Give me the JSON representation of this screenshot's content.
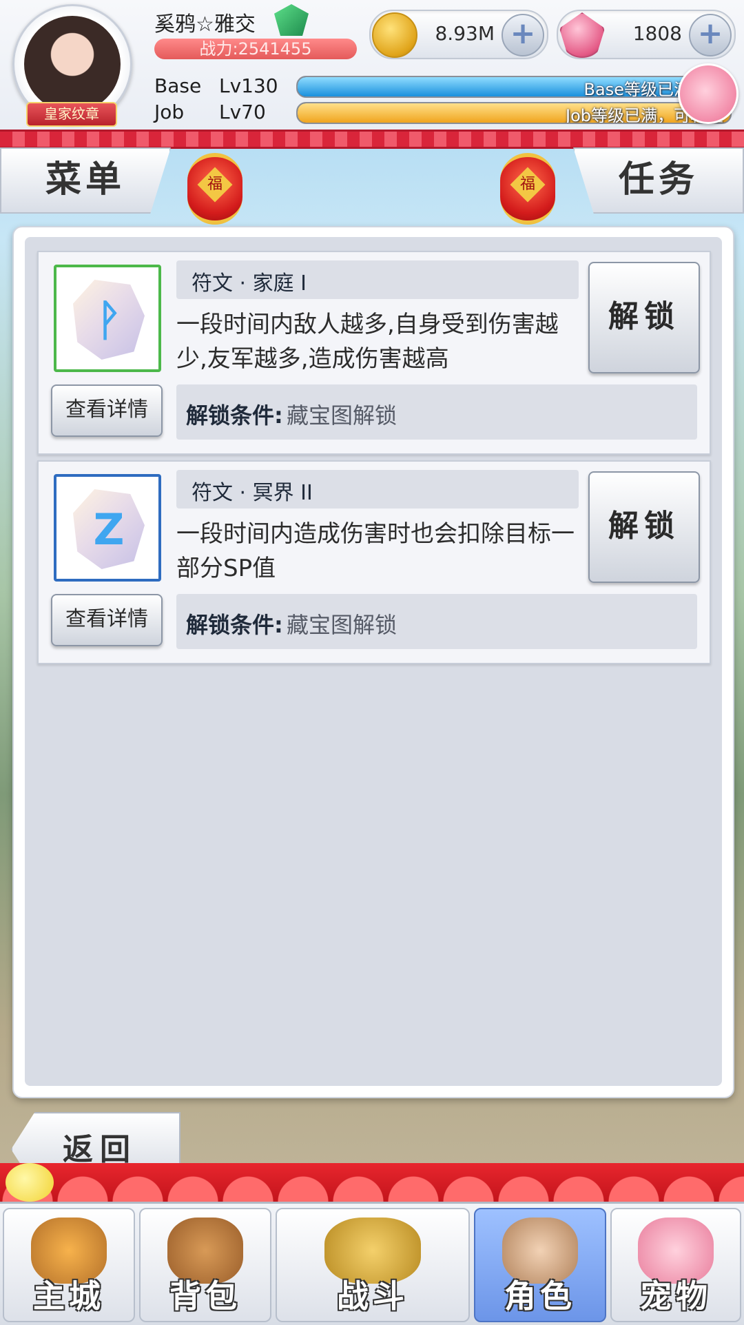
{
  "player": {
    "name": "奚鸦☆雅交",
    "power": "战力:2541455",
    "badge": "皇家纹章",
    "base_label": "Base",
    "base_level": "Lv130",
    "job_label": "Job",
    "job_level": "Lv70",
    "base_bar_text": "Base等级已满，可",
    "job_bar_text": "Job等级已满，可转生",
    "base_progress": 1.0,
    "job_progress": 1.0
  },
  "currency": {
    "zeny": "8.93M",
    "gems": "1808",
    "plus": "+"
  },
  "header": {
    "menu": "菜单",
    "task": "任务",
    "lantern_char": "福"
  },
  "runes": [
    {
      "title": "符文 · 家庭 I",
      "glyph": "ᚹ",
      "description": "一段时间内敌人越多,自身受到伤害越少,友军越多,造成伤害越高",
      "unlock": "解锁",
      "details": "查看详情",
      "condition_label": "解锁条件:",
      "condition_value": "藏宝图解锁",
      "frame_color": "#4cb84a"
    },
    {
      "title": "符文 · 冥界 II",
      "glyph": "Z",
      "description": "一段时间内造成伤害时也会扣除目标一部分SP值",
      "unlock": "解锁",
      "details": "查看详情",
      "condition_label": "解锁条件:",
      "condition_value": "藏宝图解锁",
      "frame_color": "#2e6cc0"
    }
  ],
  "back": "返回",
  "nav": {
    "city": "主城",
    "bag": "背包",
    "battle": "战斗",
    "role": "角色",
    "pet": "宠物",
    "active": "role"
  }
}
